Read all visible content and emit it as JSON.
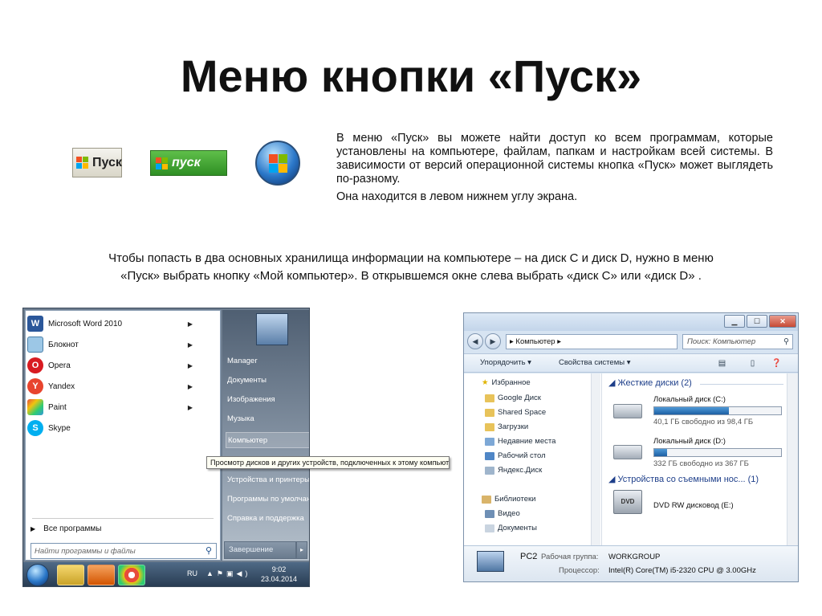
{
  "title": "Меню кнопки «Пуск»",
  "buttons": {
    "xp_classic_label": "Пуск",
    "xp_green_label": "пуск"
  },
  "description": [
    "В меню «Пуск» вы можете найти доступ ко всем программам, которые установлены на компьютере, файлам, папкам и настройкам всей системы. В зависимости от версий операционной системы кнопка «Пуск» может выглядеть по-разному.",
    "Она находится в левом нижнем углу экрана."
  ],
  "paragraph2": [
    "Чтобы попасть в два основных хранилища информации на компьютере – на диск С и диск D, нужно в меню",
    "«Пуск» выбрать кнопку «Мой компьютер». В открывшемся окне слева выбрать «диск С» или «диск D» ."
  ],
  "start_menu": {
    "programs": [
      {
        "label": "Microsoft Word 2010",
        "icon": "W"
      },
      {
        "label": "Блокнот",
        "icon": ""
      },
      {
        "label": "Opera",
        "icon": "O"
      },
      {
        "label": "Yandex",
        "icon": "Y"
      },
      {
        "label": "Paint",
        "icon": ""
      },
      {
        "label": "Skype",
        "icon": "S"
      }
    ],
    "all_programs": "Все программы",
    "search_placeholder": "Найти программы и файлы",
    "right_items": [
      "Manager",
      "Документы",
      "Изображения",
      "Музыка",
      "Компьютер",
      "Устройства и принтеры",
      "Программы по умолчанию",
      "Справка и поддержка"
    ],
    "shutdown": "Завершение работы",
    "tooltip": "Просмотр дисков и других устройств, подключенных к этому компьютеру.",
    "taskbar": {
      "lang": "RU",
      "time": "9:02",
      "date": "23.04.2014"
    }
  },
  "explorer": {
    "address": "Компьютер",
    "search_placeholder": "Поиск: Компьютер",
    "toolbar": {
      "organize": "Упорядочить",
      "system_props": "Свойства системы"
    },
    "nav": {
      "favorites_header": "Избранное",
      "favorites": [
        "Google Диск",
        "Shared Space",
        "Загрузки",
        "Недавние места",
        "Рабочий стол",
        "Яндекс.Диск"
      ],
      "libraries_header": "Библиотеки",
      "libraries": [
        "Видео",
        "Документы"
      ]
    },
    "hard_disks_header": "Жесткие диски (2)",
    "drives": [
      {
        "name": "Локальный диск (C:)",
        "free": "40,1 ГБ свободно из 98,4 ГБ",
        "used_fraction": 0.59
      },
      {
        "name": "Локальный диск (D:)",
        "free": "332 ГБ свободно из 367 ГБ",
        "used_fraction": 0.1
      }
    ],
    "removable_header": "Устройства со съемными нос... (1)",
    "dvd": {
      "name": "DVD RW дисковод (E:)",
      "icon_label": "DVD"
    },
    "details": {
      "name": "PC2",
      "workgroup_label": "Рабочая группа:",
      "workgroup": "WORKGROUP",
      "cpu_label": "Процессор:",
      "cpu": "Intel(R) Core(TM) i5-2320 CPU @ 3.00GHz"
    }
  },
  "colors": {
    "windows_flag": [
      "#f25022",
      "#7fba00",
      "#00a4ef",
      "#ffb900"
    ],
    "accent_blue": "#1e3f8a"
  }
}
